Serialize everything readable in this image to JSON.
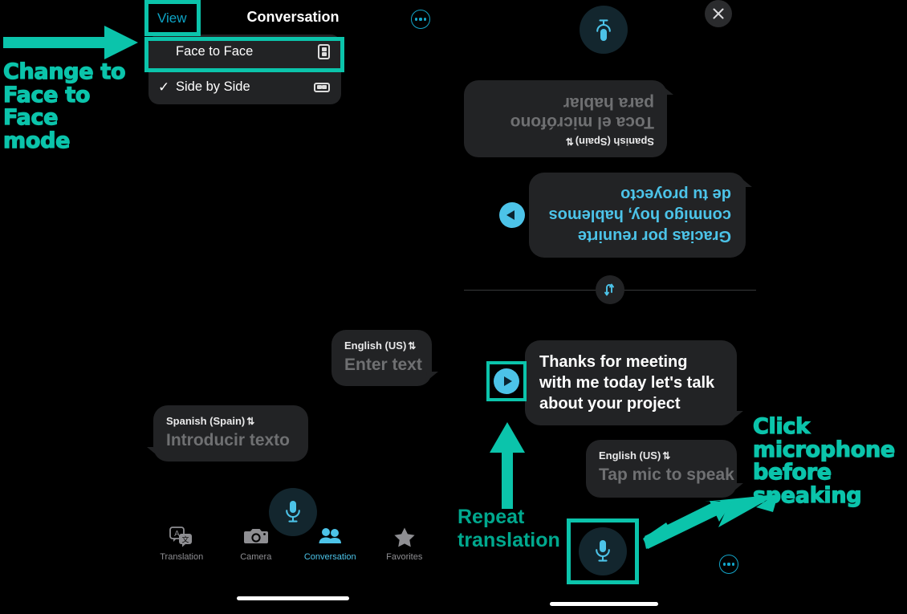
{
  "app": {
    "nav": {
      "view_button": "View",
      "title": "Conversation",
      "more_icon": "ellipsis-icon"
    },
    "view_menu": {
      "items": [
        {
          "label": "Face to Face",
          "checked": false,
          "icon": "portrait-split-icon"
        },
        {
          "label": "Side by Side",
          "checked": true,
          "checkmark": "✓",
          "icon": "landscape-split-icon"
        }
      ]
    }
  },
  "side_by_side": {
    "english_input": {
      "language": "English (US)",
      "chevron": "⇅",
      "placeholder": "Enter text"
    },
    "spanish_input": {
      "language": "Spanish (Spain)",
      "chevron": "⇅",
      "placeholder": "Introducir texto"
    },
    "mic_button": "microphone-icon",
    "tabs": [
      {
        "label": "Translation",
        "icon": "translation-icon",
        "active": false
      },
      {
        "label": "Camera",
        "icon": "camera-icon",
        "active": false
      },
      {
        "label": "Conversation",
        "icon": "people-icon",
        "active": true
      },
      {
        "label": "Favorites",
        "icon": "star-icon",
        "active": false
      }
    ]
  },
  "face_to_face": {
    "close_icon": "close-icon",
    "top_mic_icon": "microphone-icon",
    "top_bubble": {
      "language": "Spanish (Spain)",
      "chevron": "⇅",
      "placeholder": "Toca el micrófono para hablar"
    },
    "spanish_message": "Gracias por reunirte conmigo hoy, hablemos de tu proyecto",
    "divider_icon": "swap-languages-icon",
    "english_message": "Thanks for meeting with me today let's talk about your project",
    "play_icon": "play-icon",
    "bottom_bubble": {
      "language": "English (US)",
      "chevron": "⇅",
      "placeholder": "Tap mic to speak"
    },
    "bottom_mic_icon": "microphone-icon",
    "bottom_more_icon": "ellipsis-icon"
  },
  "annotations": {
    "accent_color": "#0bc4ab",
    "plain_color": "#00a88e",
    "change_mode": "Change to\nFace to Face\nmode",
    "change_mode_lines": [
      "Change to",
      "Face to Face",
      "mode"
    ],
    "repeat_translation_lines": [
      "Repeat",
      "translation"
    ],
    "click_microphone_lines": [
      "Click",
      "microphone",
      "before speaking"
    ],
    "arrow_right_icon": "arrow-right-icon",
    "arrow_up_icon": "arrow-up-icon",
    "arrow_diagonal_icon": "arrow-diagonal-left-icon"
  }
}
